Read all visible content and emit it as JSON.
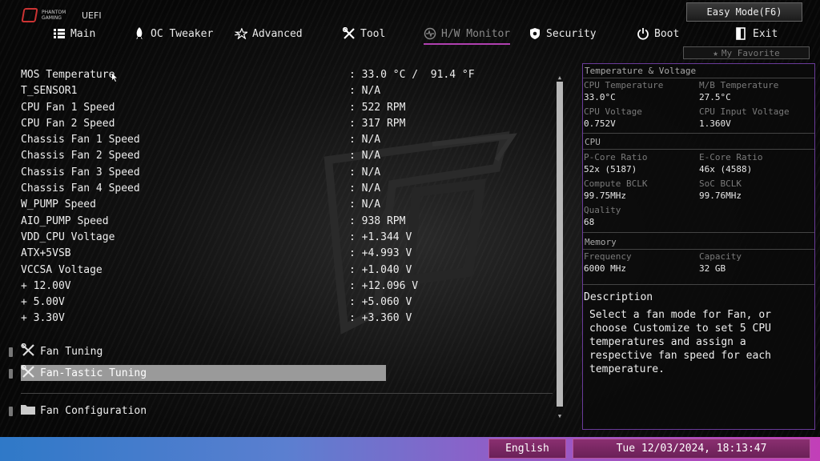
{
  "header": {
    "brand_small": "PHANTOM GAMING",
    "brand_uefi": "UEFI",
    "easy_mode": "Easy Mode(F6)",
    "favorite": "My Favorite"
  },
  "nav": [
    {
      "label": "Main",
      "icon": "list-icon"
    },
    {
      "label": "OC Tweaker",
      "icon": "rocket-icon"
    },
    {
      "label": "Advanced",
      "icon": "star-icon"
    },
    {
      "label": "Tool",
      "icon": "wrench-icon"
    },
    {
      "label": "H/W Monitor",
      "icon": "monitor-icon",
      "active": true
    },
    {
      "label": "Security",
      "icon": "shield-icon"
    },
    {
      "label": "Boot",
      "icon": "power-icon"
    },
    {
      "label": "Exit",
      "icon": "exit-icon"
    }
  ],
  "monitor": [
    {
      "label": "MOS Temperature",
      "value": ": 33.0 °C /  91.4 °F"
    },
    {
      "label": "T_SENSOR1",
      "value": ": N/A"
    },
    {
      "label": "CPU Fan 1 Speed",
      "value": ": 522 RPM"
    },
    {
      "label": "CPU Fan 2 Speed",
      "value": ": 317 RPM"
    },
    {
      "label": "Chassis Fan 1 Speed",
      "value": ": N/A"
    },
    {
      "label": "Chassis Fan 2 Speed",
      "value": ": N/A"
    },
    {
      "label": "Chassis Fan 3 Speed",
      "value": ": N/A"
    },
    {
      "label": "Chassis Fan 4 Speed",
      "value": ": N/A"
    },
    {
      "label": "W_PUMP Speed",
      "value": ": N/A"
    },
    {
      "label": "AIO_PUMP Speed",
      "value": ": 938 RPM"
    },
    {
      "label": "VDD_CPU Voltage",
      "value": ": +1.344 V"
    },
    {
      "label": "ATX+5VSB",
      "value": ": +4.993 V"
    },
    {
      "label": "VCCSA Voltage",
      "value": ": +1.040 V"
    },
    {
      "label": "+ 12.00V",
      "value": ": +12.096 V"
    },
    {
      "label": "+ 5.00V",
      "value": ": +5.060 V"
    },
    {
      "label": "+ 3.30V",
      "value": ": +3.360 V"
    }
  ],
  "menu": {
    "fan_tuning": "Fan Tuning",
    "fan_tastic": "Fan-Tastic Tuning",
    "fan_config": "Fan Configuration"
  },
  "panel": {
    "tv_title": "Temperature & Voltage",
    "cpu_temp_k": "CPU Temperature",
    "cpu_temp_v": "33.0°C",
    "mb_temp_k": "M/B Temperature",
    "mb_temp_v": "27.5°C",
    "cpu_volt_k": "CPU Voltage",
    "cpu_volt_v": "0.752V",
    "cpu_in_k": "CPU Input Voltage",
    "cpu_in_v": "1.360V",
    "cpu_title": "CPU",
    "pcore_k": "P-Core Ratio",
    "pcore_v": "52x (5187)",
    "ecore_k": "E-Core Ratio",
    "ecore_v": "46x (4588)",
    "bclk_k": "Compute BCLK",
    "bclk_v": "99.75MHz",
    "soc_k": "SoC BCLK",
    "soc_v": "99.76MHz",
    "quality_k": "Quality",
    "quality_v": "68",
    "mem_title": "Memory",
    "freq_k": "Frequency",
    "freq_v": "6000 MHz",
    "cap_k": "Capacity",
    "cap_v": "32 GB",
    "desc_title": "Description",
    "desc_text": "Select a fan mode for Fan, or choose Customize to set 5 CPU temperatures and assign a respective fan speed for each temperature."
  },
  "footer": {
    "language": "English",
    "datetime": "Tue 12/03/2024, 18:13:47"
  },
  "colors": {
    "accent": "#b040b0",
    "panel_border": "#6a3b9a"
  }
}
